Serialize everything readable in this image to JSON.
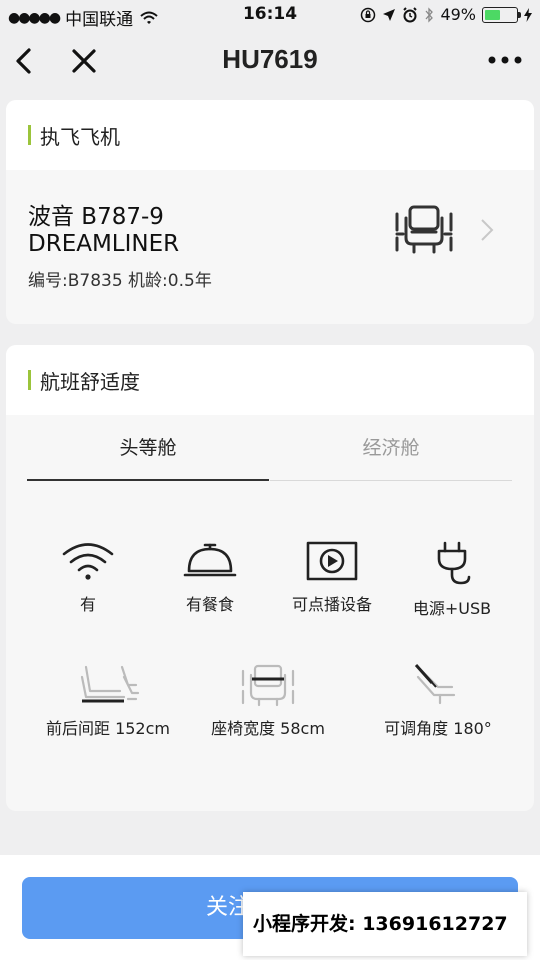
{
  "status": {
    "carrier": "中国联通",
    "time": "16:14",
    "battery": "49%",
    "battery_level": 0.49
  },
  "nav": {
    "title": "HU7619"
  },
  "aircraft_card": {
    "heading": "执飞飞机",
    "model_line1": "波音 B787-9",
    "model_line2": "DREAMLINER",
    "registration": "编号:B7835 机龄:0.5年"
  },
  "comfort_card": {
    "heading": "航班舒适度",
    "tabs": [
      "头等舱",
      "经济舱"
    ],
    "selected_tab": "头等舱",
    "amenities": [
      "有",
      "有餐食",
      "可点播设备",
      "电源+USB"
    ],
    "seat_specs": [
      "前后间距 152cm",
      "座椅宽度 58cm",
      "可调角度 180°"
    ]
  },
  "bottom": {
    "follow_label": "关注",
    "promo_text": "小程序开发: 13691612727"
  },
  "colors": {
    "accent_bar": "#9bc43b",
    "button": "#5b9bf2",
    "battery": "#4cd964"
  }
}
